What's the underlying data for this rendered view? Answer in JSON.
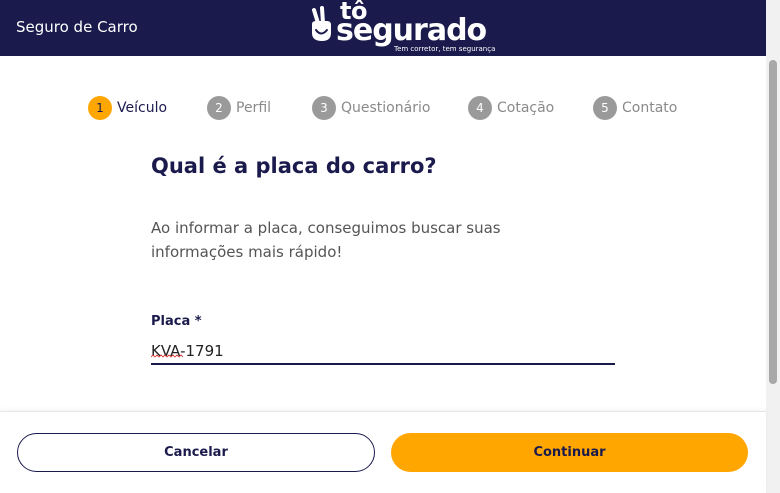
{
  "header": {
    "title": "Seguro de Carro",
    "logo": {
      "top_text": "tô",
      "main_text": "segurado",
      "tagline": "Tem corretor, tem segurança"
    }
  },
  "stepper": {
    "steps": [
      {
        "number": "1",
        "label": "Veículo",
        "active": true
      },
      {
        "number": "2",
        "label": "Perfil",
        "active": false
      },
      {
        "number": "3",
        "label": "Questionário",
        "active": false
      },
      {
        "number": "4",
        "label": "Cotação",
        "active": false
      },
      {
        "number": "5",
        "label": "Contato",
        "active": false
      }
    ]
  },
  "main": {
    "question": "Qual é a placa do carro?",
    "description": "Ao informar a placa, conseguimos buscar suas informações mais rápido!",
    "plate_field": {
      "label": "Placa *",
      "value": "KVA-1791"
    }
  },
  "footer": {
    "cancel_label": "Cancelar",
    "continue_label": "Continuar"
  },
  "colors": {
    "header_bg": "#1b1a4c",
    "accent": "#ffa600",
    "inactive_step": "#9a9a9a"
  }
}
